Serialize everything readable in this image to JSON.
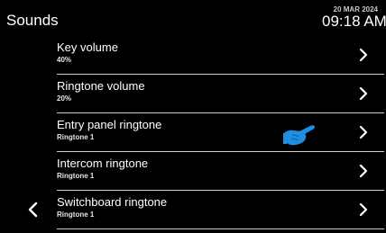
{
  "header": {
    "title": "Sounds",
    "date": "20 MAR 2024",
    "time": "09:18 AM"
  },
  "items": [
    {
      "label": "Key volume",
      "value": "40%"
    },
    {
      "label": "Ringtone volume",
      "value": "20%"
    },
    {
      "label": "Entry panel ringtone",
      "value": "Ringtone 1"
    },
    {
      "label": "Intercom ringtone",
      "value": "Ringtone 1"
    },
    {
      "label": "Switchboard ringtone",
      "value": "Ringtone 1"
    }
  ],
  "icons": {
    "back": "chevron-left-icon",
    "row_arrow": "chevron-right-icon",
    "pointer": "hand-pointer-icon"
  },
  "colors": {
    "background": "#000000",
    "text": "#ffffff",
    "divider": "#cfcfcf",
    "pointer": "#1e8fe0"
  }
}
